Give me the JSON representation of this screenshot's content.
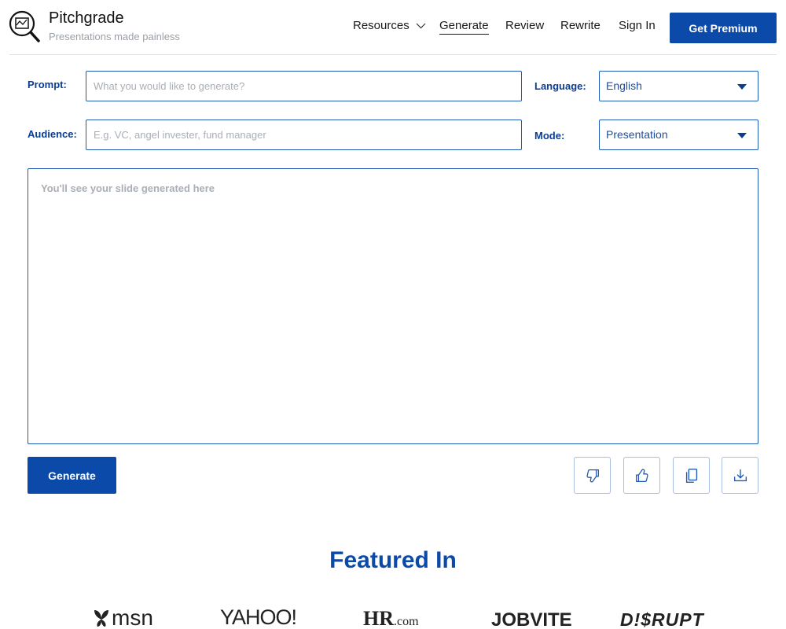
{
  "brand": {
    "title": "Pitchgrade",
    "subtitle": "Presentations made painless"
  },
  "nav": {
    "resources": "Resources",
    "generate": "Generate",
    "review": "Review",
    "rewrite": "Rewrite",
    "sign_in": "Sign In",
    "premium": "Get Premium"
  },
  "form": {
    "prompt_label": "Prompt:",
    "prompt_placeholder": "What you would like to generate?",
    "prompt_value": "",
    "audience_label": "Audience:",
    "audience_placeholder": "E.g. VC, angel invester, fund manager",
    "audience_value": "",
    "language_label": "Language:",
    "language_value": "English",
    "mode_label": "Mode:",
    "mode_value": "Presentation"
  },
  "output": {
    "placeholder": "You'll see your slide generated here"
  },
  "actions": {
    "generate_label": "Generate",
    "icons": [
      "thumbs-down-icon",
      "thumbs-up-icon",
      "copy-icon",
      "download-icon"
    ]
  },
  "featured": {
    "heading": "Featured In",
    "logos": [
      "msn",
      "YAHOO!",
      "HR",
      ".com",
      "JOBVITE",
      "D!$RUPT"
    ]
  },
  "colors": {
    "primary": "#0b4aa8",
    "label": "#0b3d91",
    "border": "#1f5bb5",
    "placeholder": "#a9afb7"
  }
}
